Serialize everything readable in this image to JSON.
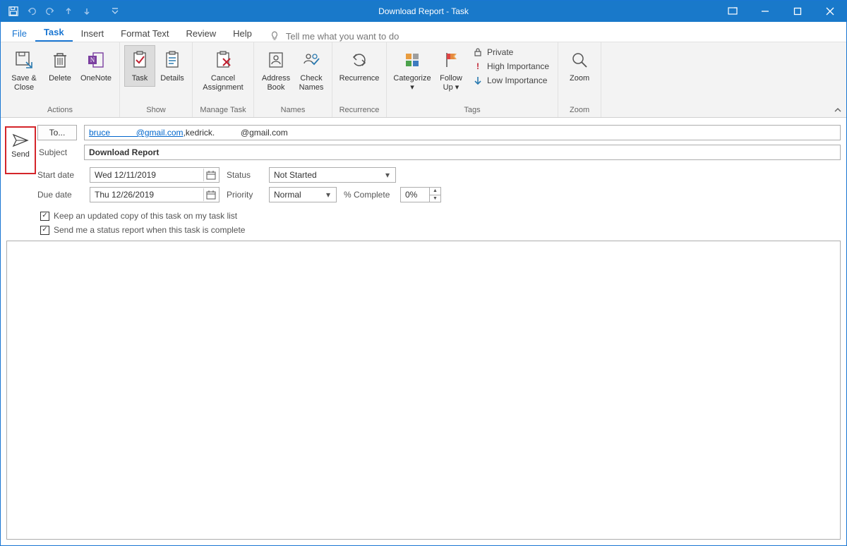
{
  "titlebar": {
    "title": "Download Report  -  Task"
  },
  "tabs": {
    "file": "File",
    "items": [
      "Task",
      "Insert",
      "Format Text",
      "Review",
      "Help"
    ],
    "active": "Task",
    "tellme": "Tell me what you want to do"
  },
  "ribbon": {
    "actions": {
      "label": "Actions",
      "save_close": "Save &\nClose",
      "delete": "Delete",
      "onenote": "OneNote"
    },
    "show": {
      "label": "Show",
      "task": "Task",
      "details": "Details"
    },
    "manage": {
      "label": "Manage Task",
      "cancel": "Cancel\nAssignment"
    },
    "names": {
      "label": "Names",
      "address_book": "Address\nBook",
      "check_names": "Check\nNames"
    },
    "recurrence": {
      "label": "Recurrence",
      "btn": "Recurrence"
    },
    "tags": {
      "label": "Tags",
      "categorize": "Categorize",
      "follow_up": "Follow\nUp",
      "private": "Private",
      "high": "High Importance",
      "low": "Low Importance"
    },
    "zoom": {
      "label": "Zoom",
      "btn": "Zoom"
    }
  },
  "form": {
    "send": "Send",
    "to_btn": "To...",
    "to_value_linked": "bruce           @gmail.com",
    "to_value_sep": ", ",
    "to_value_plain": "kedrick.           @gmail.com",
    "subject_label": "Subject",
    "subject_value": "Download Report",
    "start_label": "Start date",
    "start_value": "Wed 12/11/2019",
    "due_label": "Due date",
    "due_value": "Thu 12/26/2019",
    "status_label": "Status",
    "status_value": "Not Started",
    "priority_label": "Priority",
    "priority_value": "Normal",
    "pct_label": "% Complete",
    "pct_value": "0%",
    "chk1": "Keep an updated copy of this task on my task list",
    "chk2": "Send me a status report when this task is complete"
  }
}
